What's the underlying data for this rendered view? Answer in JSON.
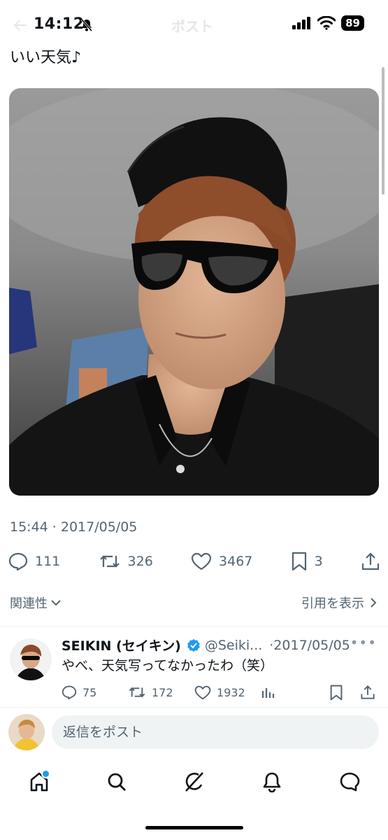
{
  "status_bar": {
    "time": "14:12",
    "battery": "89"
  },
  "header": {
    "title": "ポスト"
  },
  "post": {
    "text": "いい天気♪",
    "timestamp": "15:44 · 2017/05/05",
    "stats": {
      "replies": "111",
      "reposts": "326",
      "likes": "3467",
      "bookmarks": "3"
    }
  },
  "related": {
    "label": "関連性",
    "quotes_label": "引用を表示"
  },
  "reply": {
    "name": "SEIKIN (セイキン)",
    "handle": "@Seiki...",
    "date": "·2017/05/05",
    "text": "やべ、天気写ってなかったわ（笑）",
    "stats": {
      "replies": "75",
      "reposts": "172",
      "likes": "1932"
    }
  },
  "compose": {
    "placeholder": "返信をポスト"
  },
  "colors": {
    "accent": "#1d9bf0",
    "muted": "#536471",
    "text": "#0f1419"
  }
}
